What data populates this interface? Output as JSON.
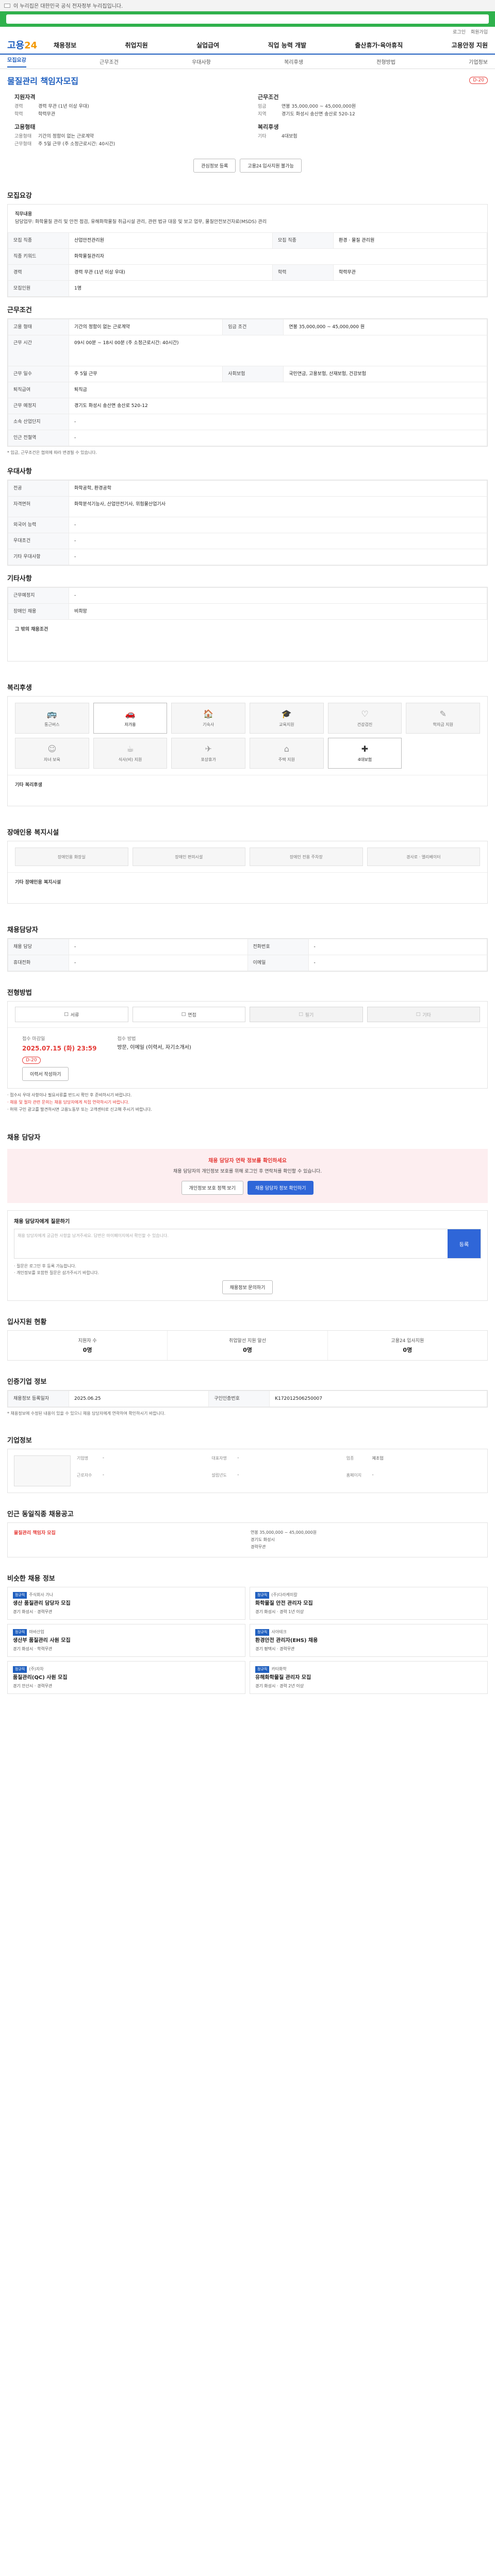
{
  "gov": {
    "text": "이 누리집은 대한민국 공식 전자정부 누리집입니다."
  },
  "util": [
    "로그인",
    "회원가입"
  ],
  "logo": {
    "a": "고용",
    "b": "24"
  },
  "gnb": [
    "채용정보",
    "취업지원",
    "실업급여",
    "직업 능력 개발",
    "출산휴가·육아휴직",
    "고용안정 지원"
  ],
  "tabs": [
    "모집요강",
    "근무조건",
    "우대사항",
    "복리후생",
    "전형방법",
    "기업정보"
  ],
  "posting": {
    "title": "물질관리 책임자모집",
    "badge": "D-20",
    "company_head": "지원자격",
    "cond_head": "근무조건",
    "rows_left": [
      {
        "k": "경력",
        "v": "경력 무관 (1년 이상 우대)"
      },
      {
        "k": "학력",
        "v": "학력무관"
      }
    ],
    "rows_right": [
      {
        "k": "임금",
        "v": "연봉 35,000,000 ~ 45,000,000원"
      },
      {
        "k": "지역",
        "v": "경기도 화성시 송산면 송산로 520-12"
      }
    ],
    "emp_head": "고용형태",
    "emp_rows": [
      {
        "k": "고용형태",
        "v": "기간의 정함이 없는 근로계약"
      },
      {
        "k": "근무형태",
        "v": "주 5일 근무 (주 소정근로시간: 40시간)"
      }
    ],
    "welfare_head": "복리후생",
    "welfare_rows": [
      {
        "k": "기타",
        "v": "4대보험"
      }
    ],
    "btn_scrap": "관심정보 등록",
    "btn_apply": "고용24 입사지원 불가능"
  },
  "recruit": {
    "head": "모집요강",
    "job_head": "직무내용",
    "job_text": "담당업무: 화학물질 관리 및 안전 점검, 유해화학물질 취급시설 관리, 관련 법규 대응 및 보고 업무, 물질안전보건자료(MSDS) 관리",
    "rows": [
      {
        "k": "모집 직종",
        "v": "산업안전관리원"
      },
      {
        "k": "모집 직종",
        "v": "환경 · 물질 관리원"
      },
      {
        "k": "직종 키워드",
        "v": "화학물질관리자"
      },
      {
        "k": "경력",
        "v": "경력 무관 (1년 이상 우대)"
      },
      {
        "k": "학력",
        "v": "학력무관"
      },
      {
        "k": "모집인원",
        "v": "1명"
      }
    ]
  },
  "work": {
    "head": "근무조건",
    "rows": [
      {
        "k": "고용 형태",
        "v": "기간의 정함이 없는 근로계약"
      },
      {
        "k": "임금 조건",
        "v": "연봉 35,000,000 ~ 45,000,000 원"
      },
      {
        "k": "근무 시간",
        "v": "09시 00분 ~ 18시 00분 (주 소정근로시간: 40시간)"
      },
      {
        "k": "근무 일수",
        "v": "주 5일 근무"
      },
      {
        "k": "사회보험",
        "v": "국민연금, 고용보험, 산재보험, 건강보험"
      },
      {
        "k": "퇴직급여",
        "v": "퇴직금"
      },
      {
        "k": "근무 예정지",
        "v": "경기도 화성시 송산면 송산로 520-12"
      },
      {
        "k": "소속 산업단지",
        "v": "-"
      },
      {
        "k": "인근 전철역",
        "v": "-"
      }
    ],
    "note": "* 임금, 근무조건은 협의에 따라 변경될 수 있습니다."
  },
  "prefer": {
    "head": "우대사항",
    "rows": [
      {
        "k": "전공",
        "v": "화학공학, 환경공학"
      },
      {
        "k": "자격면허",
        "v": "화학분석기능사, 산업안전기사, 위험물산업기사"
      },
      {
        "k": "외국어 능력",
        "v": "-"
      },
      {
        "k": "우대조건",
        "v": "-"
      },
      {
        "k": "기타 우대사항",
        "v": "-"
      }
    ]
  },
  "etc": {
    "head": "기타사항",
    "rows": [
      {
        "k": "근무예정지",
        "v": "-"
      },
      {
        "k": "장애인 채용",
        "v": "비희망"
      }
    ],
    "extra_head": "그 밖의 채용조건"
  },
  "welfare": {
    "head": "복리후생",
    "items": [
      {
        "label": "통근버스",
        "on": false,
        "glyph": "🚌"
      },
      {
        "label": "자가용",
        "on": true,
        "glyph": "🚗"
      },
      {
        "label": "기숙사",
        "on": false,
        "glyph": "🏠"
      },
      {
        "label": "교육지원",
        "on": false,
        "glyph": "🎓"
      },
      {
        "label": "건강검진",
        "on": false,
        "glyph": "♡"
      },
      {
        "label": "학자금 지원",
        "on": false,
        "glyph": "✎"
      },
      {
        "label": "자녀 보육",
        "on": false,
        "glyph": "☺"
      },
      {
        "label": "식사(비) 지원",
        "on": false,
        "glyph": "☕"
      },
      {
        "label": "포상휴가",
        "on": false,
        "glyph": "✈"
      },
      {
        "label": "주택 지원",
        "on": false,
        "glyph": "⌂"
      },
      {
        "label": "4대보험",
        "on": true,
        "glyph": "✚"
      }
    ],
    "other_head": "기타 복리후생"
  },
  "facility": {
    "head": "장애인용 복지시설",
    "items": [
      "장애인용 화장실",
      "장애인 편의시설",
      "장애인 전용 주차장",
      "경사로 · 엘리베이터"
    ],
    "other_head": "기타 장애인용 복지시설"
  },
  "contact": {
    "head": "채용담당자",
    "rows": [
      {
        "k": "채용 담당",
        "v": "-"
      },
      {
        "k": "전화번호",
        "v": "-"
      },
      {
        "k": "휴대전화",
        "v": "-"
      },
      {
        "k": "이메일",
        "v": "-"
      }
    ]
  },
  "process": {
    "head": "전형방법",
    "steps": [
      {
        "label": "서류",
        "off": false
      },
      {
        "label": "면접",
        "off": false
      },
      {
        "label": "필기",
        "off": true
      },
      {
        "label": "기타",
        "off": true
      }
    ],
    "period_lbl": "접수 마감일",
    "period_val": "2025.07.15 (화) 23:59",
    "period_badge": "D-20",
    "method_lbl": "접수 방법",
    "method_val": "방문, 이메일 (이력서, 자기소개서)",
    "btn": "이력서 작성하기",
    "bullets": [
      "· 접수시 우대 사항이나 필요서류를 반드시 확인 후 준비하시기 바랍니다.",
      "· 채용 및 절차 관련 문의는 채용 담당자에게 직접 연락하시기 바랍니다.",
      "· 허위 구인 광고를 발견하시면 고용노동부 또는 고객센터로 신고해 주시기 바랍니다."
    ]
  },
  "guide": {
    "head": "채용 담당자",
    "hl": "채용 담당자 연락 정보를 확인하세요",
    "text": "채용 담당자의 개인정보 보호를 위해 로그인 후 연락처를 확인할 수 있습니다.",
    "btn1": "개인정보 보호 정책 보기",
    "btn2": "채용 담당자 정보 확인하기"
  },
  "memo": {
    "head": "채용 담당자에게 질문하기",
    "placeholder": "채용 담당자에게 궁금한 사항을 남겨주세요. 답변은 마이페이지에서 확인할 수 있습니다.",
    "send": "등록",
    "notes": [
      "· 질문은 로그인 후 등록 가능합니다.",
      "· 개인정보를 포함한 질문은 삼가주시기 바랍니다."
    ],
    "more": "채용정보 문의하기"
  },
  "stats": {
    "head": "입사지원 현황",
    "cells": [
      {
        "label": "지원자 수",
        "val": "0명"
      },
      {
        "label": "취업알선 지원 알선",
        "val": "0명"
      },
      {
        "label": "고용24 입사지원",
        "val": "0명"
      }
    ]
  },
  "meta": {
    "head": "인증기업 정보",
    "rows": [
      {
        "k": "채용정보 등록일자",
        "v": "2025.06.25"
      },
      {
        "k": "구인인증번호",
        "v": "K172012506250007"
      }
    ],
    "note": "* 채용정보에 수정된 내용이 있을 수 있으니 채용 담당자에게 연락하여 확인하시기 바랍니다."
  },
  "company": {
    "head": "기업정보",
    "rows": [
      {
        "k": "기업명",
        "v": "-"
      },
      {
        "k": "대표자명",
        "v": "-"
      },
      {
        "k": "업종",
        "v": "제조업"
      },
      {
        "k": "근로자수",
        "v": "-"
      },
      {
        "k": "설립년도",
        "v": "-"
      },
      {
        "k": "홈페이지",
        "v": "-"
      }
    ]
  },
  "similar": {
    "head": "인근 동일직종 채용공고",
    "sub": "물질관리 책임자 모집",
    "items": [
      "연봉 35,000,000 ~ 45,000,000원",
      "경기도 화성시",
      "경력무관"
    ]
  },
  "recommend": {
    "head": "비슷한 채용 정보",
    "cards": [
      {
        "co": "주식회사 가나",
        "tag": "정규직",
        "jt": "생산 품질관리 담당자 모집",
        "d": "경기 화성시 · 경력무관"
      },
      {
        "co": "(주)다라케미칼",
        "tag": "정규직",
        "jt": "화학물질 안전 관리자 모집",
        "d": "경기 화성시 · 경력 1년 이상"
      },
      {
        "co": "마바산업",
        "tag": "정규직",
        "jt": "생산부 품질관리 사원 모집",
        "d": "경기 화성시 · 학력무관"
      },
      {
        "co": "사아테크",
        "tag": "정규직",
        "jt": "환경안전 관리자(EHS) 채용",
        "d": "경기 평택시 · 경력무관"
      },
      {
        "co": "(주)자차",
        "tag": "정규직",
        "jt": "품질관리(QC) 사원 모집",
        "d": "경기 안산시 · 경력무관"
      },
      {
        "co": "카타화학",
        "tag": "정규직",
        "jt": "유해화학물질 관리자 모집",
        "d": "경기 화성시 · 경력 2년 이상"
      }
    ]
  }
}
